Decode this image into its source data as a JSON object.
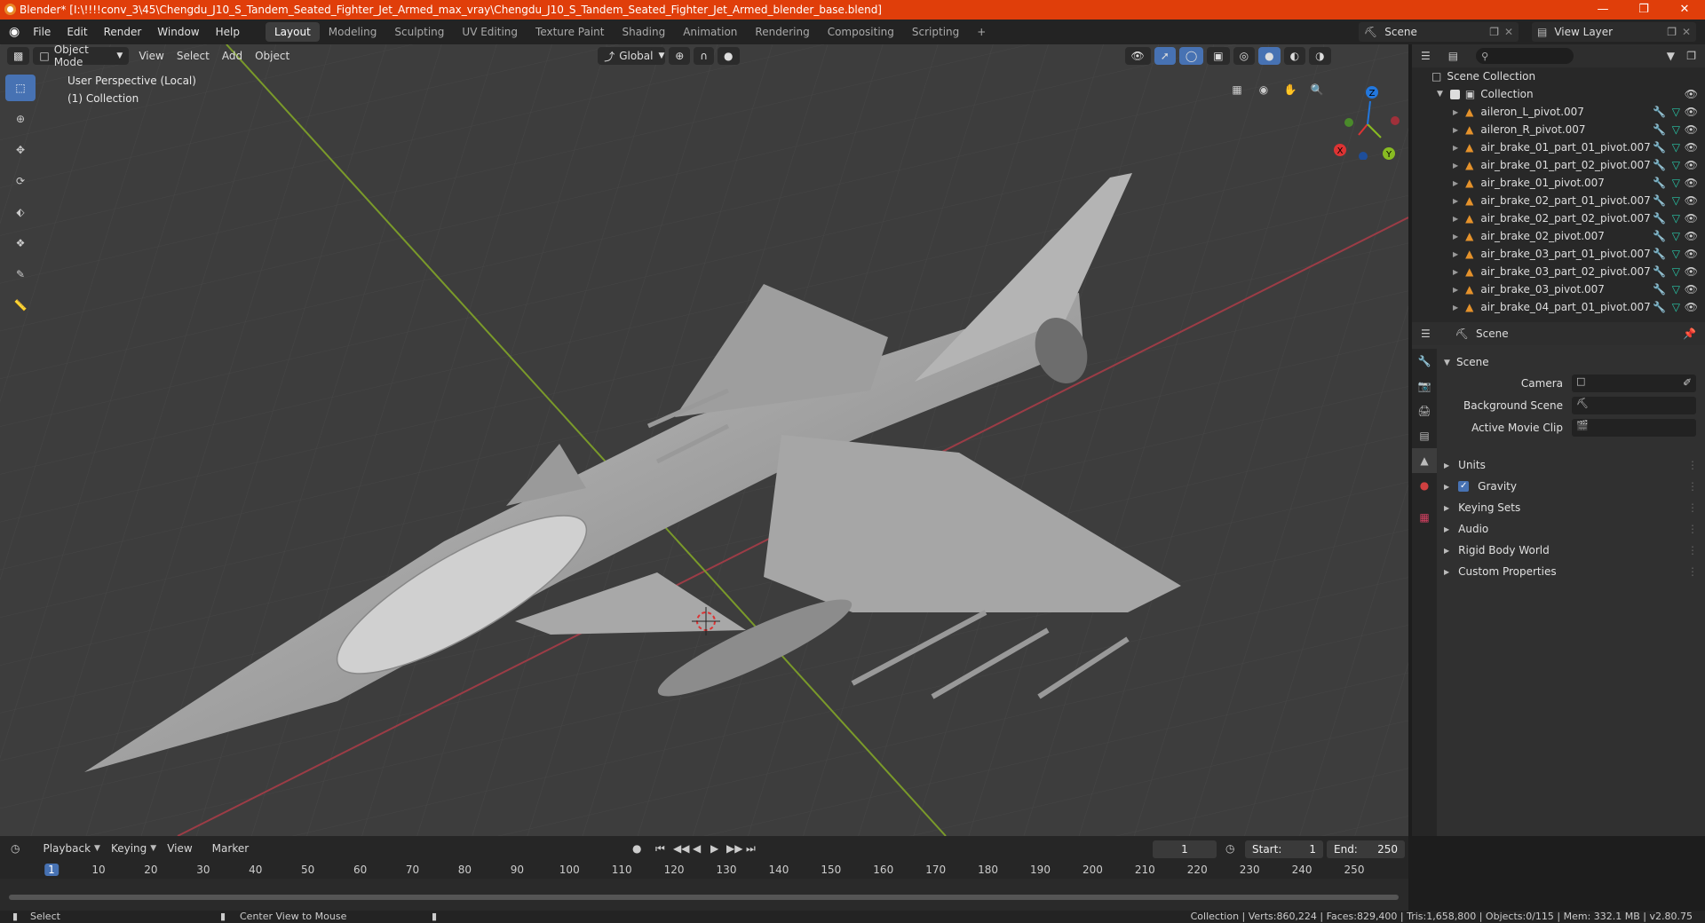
{
  "window": {
    "title": "Blender* [I:\\!!!!conv_3\\45\\Chengdu_J10_S_Tandem_Seated_Fighter_Jet_Armed_max_vray\\Chengdu_J10_S_Tandem_Seated_Fighter_Jet_Armed_blender_base.blend]",
    "accent": "#e03e0a"
  },
  "menu": [
    "File",
    "Edit",
    "Render",
    "Window",
    "Help"
  ],
  "workspaces": [
    "Layout",
    "Modeling",
    "Sculpting",
    "UV Editing",
    "Texture Paint",
    "Shading",
    "Animation",
    "Rendering",
    "Compositing",
    "Scripting"
  ],
  "active_workspace": "Layout",
  "scene_name": "Scene",
  "view_layer": "View Layer",
  "viewport": {
    "mode": "Object Mode",
    "menus": [
      "View",
      "Select",
      "Add",
      "Object"
    ],
    "orientation": "Global",
    "overlay_title": "User Perspective (Local)",
    "overlay_collection": "(1) Collection",
    "gizmo": {
      "x": "X",
      "y": "Y",
      "z": "Z"
    }
  },
  "outliner": {
    "root": "Scene Collection",
    "collection": "Collection",
    "items": [
      "aileron_L_pivot.007",
      "aileron_R_pivot.007",
      "air_brake_01_part_01_pivot.007",
      "air_brake_01_part_02_pivot.007",
      "air_brake_01_pivot.007",
      "air_brake_02_part_01_pivot.007",
      "air_brake_02_part_02_pivot.007",
      "air_brake_02_pivot.007",
      "air_brake_03_part_01_pivot.007",
      "air_brake_03_part_02_pivot.007",
      "air_brake_03_pivot.007",
      "air_brake_04_part_01_pivot.007"
    ]
  },
  "properties": {
    "header": "Scene",
    "section": "Scene",
    "camera_label": "Camera",
    "background_label": "Background Scene",
    "movieclip_label": "Active Movie Clip",
    "panels": [
      "Units",
      "Gravity",
      "Keying Sets",
      "Audio",
      "Rigid Body World",
      "Custom Properties"
    ]
  },
  "timeline": {
    "menus": [
      "Playback",
      "Keying",
      "View",
      "Marker"
    ],
    "current_frame": "1",
    "start_label": "Start:",
    "start": "1",
    "end_label": "End:",
    "end": "250",
    "ruler": [
      "1",
      "10",
      "20",
      "30",
      "40",
      "50",
      "60",
      "70",
      "80",
      "90",
      "100",
      "110",
      "120",
      "130",
      "140",
      "150",
      "160",
      "170",
      "180",
      "190",
      "200",
      "210",
      "220",
      "230",
      "240",
      "250"
    ]
  },
  "status": {
    "left": "Select",
    "middle": "Center View to Mouse",
    "right": "Collection | Verts:860,224 | Faces:829,400 | Tris:1,658,800 | Objects:0/115 | Mem: 332.1 MB | v2.80.75"
  }
}
